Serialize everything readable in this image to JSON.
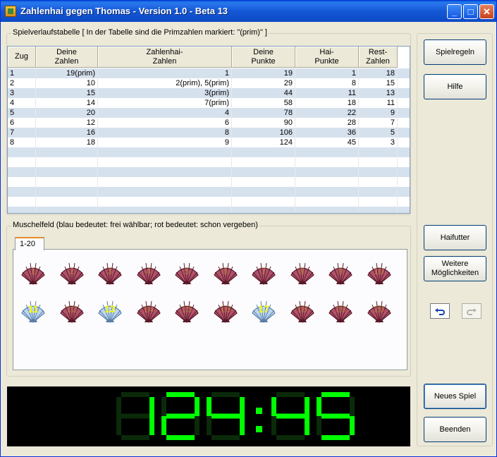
{
  "window": {
    "title": "Zahlenhai gegen Thomas - Version 1.0 - Beta 13",
    "buttons": [
      "_",
      "□",
      "✕"
    ]
  },
  "history": {
    "label": "Spielverlaufstabelle  [ In der Tabelle sind die Primzahlen markiert: \"(prim)\" ]",
    "columns": [
      "Zug",
      "Deine\nZahlen",
      "Zahlenhai-\nZahlen",
      "Deine\nPunkte",
      "Hai-\nPunkte",
      "Rest-\nZahlen"
    ],
    "rows": [
      [
        "1",
        "19(prim)",
        "1",
        "19",
        "1",
        "18"
      ],
      [
        "2",
        "10",
        "2(prim), 5(prim)",
        "29",
        "8",
        "15"
      ],
      [
        "3",
        "15",
        "3(prim)",
        "44",
        "11",
        "13"
      ],
      [
        "4",
        "14",
        "7(prim)",
        "58",
        "18",
        "11"
      ],
      [
        "5",
        "20",
        "4",
        "78",
        "22",
        "9"
      ],
      [
        "6",
        "12",
        "6",
        "90",
        "28",
        "7"
      ],
      [
        "7",
        "16",
        "8",
        "106",
        "36",
        "5"
      ],
      [
        "8",
        "18",
        "9",
        "124",
        "45",
        "3"
      ]
    ]
  },
  "shells": {
    "label": "Muschelfeld  (blau bedeutet: frei wählbar;  rot bedeutet: schon vergeben)",
    "tab": "1-20",
    "items": [
      {
        "n": "1",
        "state": "taken"
      },
      {
        "n": "2",
        "state": "taken"
      },
      {
        "n": "3",
        "state": "taken"
      },
      {
        "n": "4",
        "state": "taken"
      },
      {
        "n": "5",
        "state": "taken"
      },
      {
        "n": "6",
        "state": "taken"
      },
      {
        "n": "7",
        "state": "taken"
      },
      {
        "n": "8",
        "state": "taken"
      },
      {
        "n": "9",
        "state": "taken"
      },
      {
        "n": "10",
        "state": "taken"
      },
      {
        "n": "11",
        "state": "free"
      },
      {
        "n": "12",
        "state": "taken"
      },
      {
        "n": "13",
        "state": "free"
      },
      {
        "n": "14",
        "state": "taken"
      },
      {
        "n": "15",
        "state": "taken"
      },
      {
        "n": "16",
        "state": "taken"
      },
      {
        "n": "17",
        "state": "free"
      },
      {
        "n": "18",
        "state": "taken"
      },
      {
        "n": "19",
        "state": "taken"
      },
      {
        "n": "20",
        "state": "taken"
      }
    ]
  },
  "score_display": "124:45",
  "colors": {
    "free": "#bcd6f2",
    "taken": "#b0526a",
    "digits": "#00ff00",
    "digits_off": "#0a2a0a"
  },
  "sidebar": {
    "rules": "Spielregeln",
    "help": "Hilfe",
    "shark_food": "Haifutter",
    "more": "Weitere\nMöglichkeiten",
    "undo_icon": "undo-icon",
    "redo_icon": "redo-icon",
    "new_game": "Neues Spiel",
    "quit": "Beenden"
  }
}
